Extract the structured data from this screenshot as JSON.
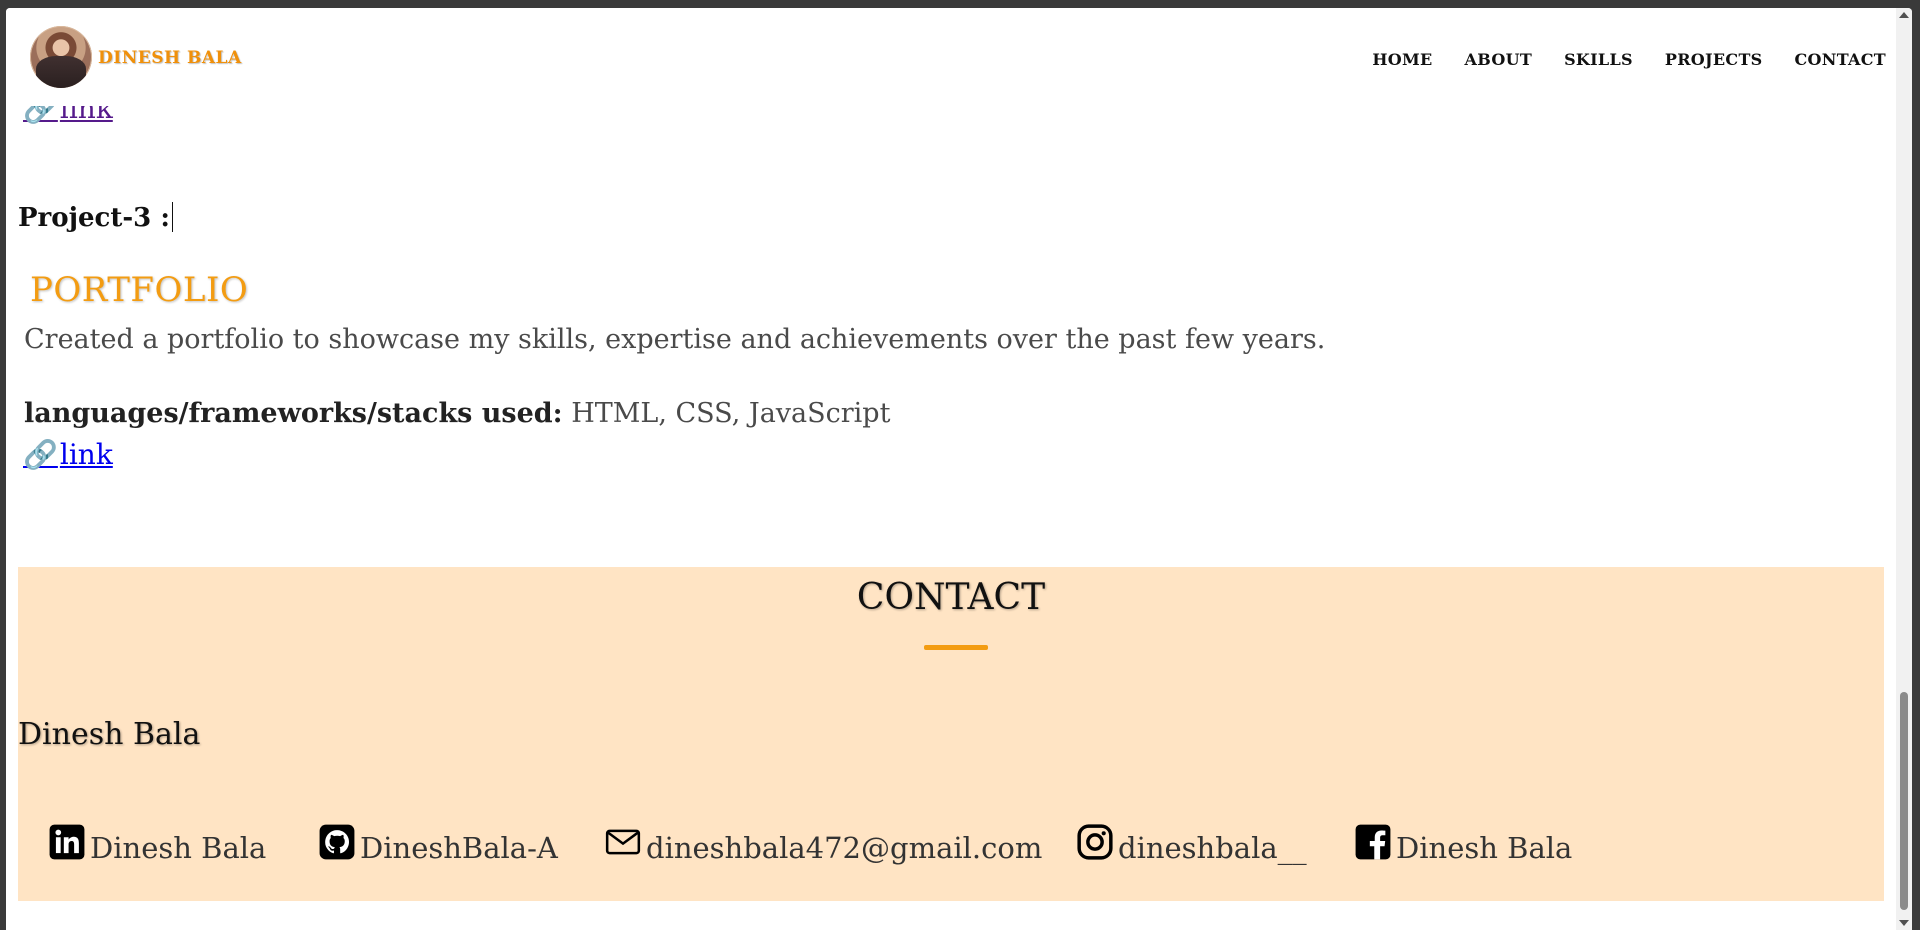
{
  "header": {
    "brand": "DINESH BALA",
    "nav": [
      "HOME",
      "ABOUT",
      "SKILLS",
      "PROJECTS",
      "CONTACT"
    ]
  },
  "prev_project": {
    "link_label": "link",
    "link_icon": "link-icon"
  },
  "project3": {
    "label": "Project-3 :",
    "title": "PORTFOLIO",
    "description": "Created a portfolio to showcase my skills, expertise and achievements over the past few years.",
    "stack_label": "languages/frameworks/stacks used:",
    "stack_value": " HTML, CSS, JavaScript",
    "link_label": "link",
    "link_icon": "link-icon"
  },
  "contact": {
    "heading": "CONTACT",
    "name": "Dinesh Bala",
    "socials": [
      {
        "icon": "linkedin-icon",
        "label": "Dinesh Bala"
      },
      {
        "icon": "github-icon",
        "label": "DineshBala-A"
      },
      {
        "icon": "mail-icon",
        "label": "dineshbala472@gmail.com"
      },
      {
        "icon": "instagram-icon",
        "label": "dineshbala__"
      },
      {
        "icon": "facebook-icon",
        "label": "Dinesh Bala"
      }
    ]
  },
  "colors": {
    "accent": "#f39c12",
    "contact_bg": "#ffe4c4"
  }
}
